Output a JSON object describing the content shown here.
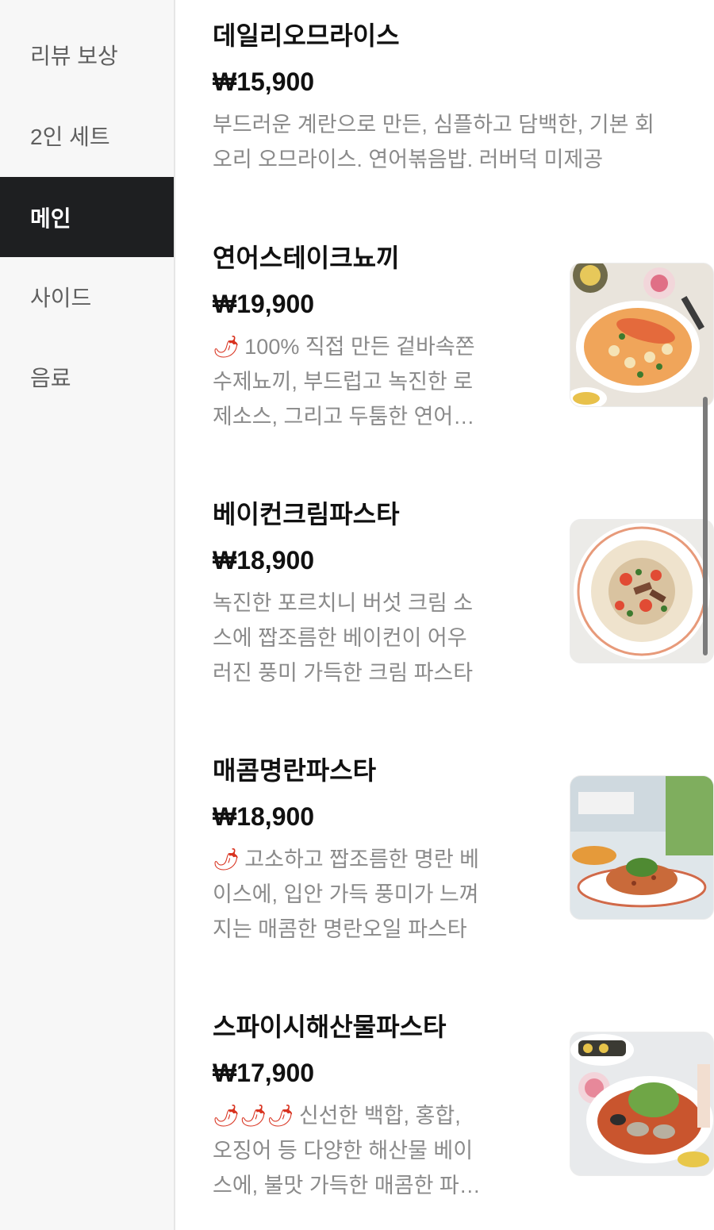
{
  "sidebar": {
    "categories": [
      {
        "label": "리뷰 보상"
      },
      {
        "label": "2인 세트"
      },
      {
        "label": "메인"
      },
      {
        "label": "사이드"
      },
      {
        "label": "음료"
      }
    ]
  },
  "menu_items": [
    {
      "name": "데일리오므라이스",
      "price": "₩15,900",
      "description": "부드러운 계란으로 만든, 심플하고 담백한, 기본 회오리 오므라이스. 연어볶음밥. 러버덕 미제공"
    },
    {
      "name": "연어스테이크뇨끼",
      "price": "₩19,900",
      "spicy_icons": "🌶",
      "description": "100% 직접 만든 겉바속쫀 수제뇨끼, 부드럽고 녹진한 로제소스, 그리고 두툼한 연어스테이크"
    },
    {
      "name": "베이컨크림파스타",
      "price": "₩18,900",
      "description": "녹진한 포르치니 버섯 크림 소스에 짭조름한 베이컨이 어우러진 풍미 가득한 크림 파스타"
    },
    {
      "name": "매콤명란파스타",
      "price": "₩18,900",
      "spicy_icons": "🌶",
      "description": "고소하고 짭조름한 명란 베이스에, 입안 가득 풍미가 느껴지는 매콤한 명란오일 파스타"
    },
    {
      "name": "스파이시해산물파스타",
      "price": "₩17,900",
      "spicy_icons": "🌶🌶🌶",
      "description": "신선한 백합, 홍합, 오징어 등 다양한 해산물 베이스에, 불맛 가득한 매콤한 파스타"
    }
  ],
  "colors": {
    "active_category_bg": "#1e1f21",
    "sidebar_bg": "#f7f7f7",
    "description_text": "#8a8a8a",
    "chili": "#d8321f"
  }
}
